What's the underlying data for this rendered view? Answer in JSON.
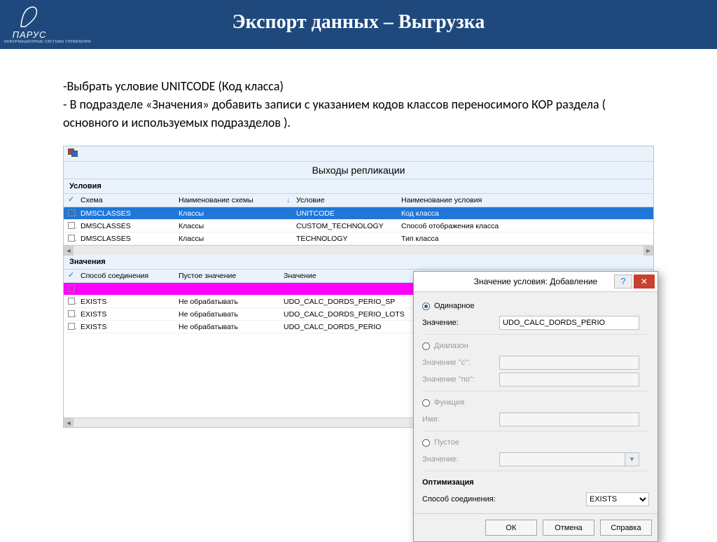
{
  "slide": {
    "title": "Экспорт данных – Выгрузка",
    "logo_text": "ПАРУС",
    "logo_sub": "ИНФОРМАЦИОННЫЕ СИСТЕМЫ УПРАВЛЕНИЯ",
    "b1": "-Выбрать условие UNITCODE (Код класса)",
    "b2": "- В подразделе «Значения» добавить записи с указанием кодов классов переносимого КОР раздела ( основного и используемых подразделов )."
  },
  "app": {
    "title": "Выходы репликации",
    "cond_section": "Условия",
    "val_section": "Значения",
    "cond_cols": {
      "c0": "Схема",
      "c1": "Наименование схемы",
      "c2": "Условие",
      "c3": "Наименование условия"
    },
    "cond_rows": [
      {
        "schema": "DMSCLASSES",
        "name": "Классы",
        "cond": "UNITCODE",
        "condname": "Код класса",
        "selected": true
      },
      {
        "schema": "DMSCLASSES",
        "name": "Классы",
        "cond": "CUSTOM_TECHNOLOGY",
        "condname": "Способ отображения класса"
      },
      {
        "schema": "DMSCLASSES",
        "name": "Классы",
        "cond": "TECHNOLOGY",
        "condname": "Тип класса"
      }
    ],
    "val_cols": {
      "c0": "Способ соединения",
      "c1": "Пустое значение",
      "c2": "Значение"
    },
    "val_rows": [
      {
        "j": "",
        "e": "",
        "v": "",
        "selected": true
      },
      {
        "j": "EXISTS",
        "e": "Не обрабатывать",
        "v": "UDO_CALC_DORDS_PERIO_SP"
      },
      {
        "j": "EXISTS",
        "e": "Не обрабатывать",
        "v": "UDO_CALC_DORDS_PERIO_LOTS"
      },
      {
        "j": "EXISTS",
        "e": "Не обрабатывать",
        "v": "UDO_CALC_DORDS_PERIO"
      }
    ]
  },
  "dlg": {
    "title": "Значение условия: Добавление",
    "r_single": "Одинарное",
    "l_val": "Значение:",
    "val": "UDO_CALC_DORDS_PERIO",
    "r_range": "Диапазон",
    "l_from": "Значение \"с\":",
    "l_to": "Значение \"по\":",
    "r_func": "Функция",
    "l_name": "Имя:",
    "r_empty": "Пустое",
    "l_val2": "Значение:",
    "opt": "Оптимизация",
    "l_join": "Способ соединения:",
    "join": "EXISTS",
    "ok": "ОК",
    "cancel": "Отмена",
    "help": "Справка"
  }
}
